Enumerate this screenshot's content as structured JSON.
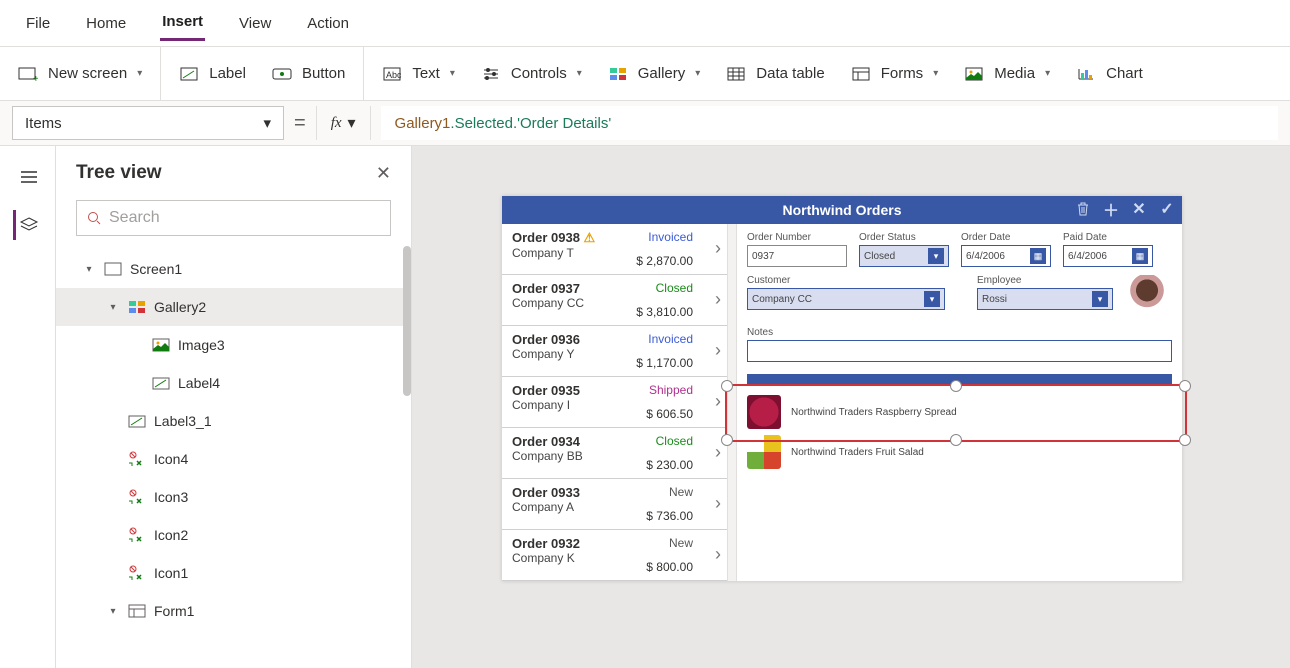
{
  "menu": {
    "items": [
      "File",
      "Home",
      "Insert",
      "View",
      "Action"
    ],
    "active": 2
  },
  "ribbon": {
    "newScreen": "New screen",
    "label": "Label",
    "button": "Button",
    "text": "Text",
    "controls": "Controls",
    "gallery": "Gallery",
    "dataTable": "Data table",
    "forms": "Forms",
    "media": "Media",
    "chart": "Chart"
  },
  "formula": {
    "property": "Items",
    "fx": "fx",
    "expr_obj": "Gallery1",
    "expr_rest": ".Selected.'Order Details'"
  },
  "side": {
    "title": "Tree view",
    "search_ph": "Search",
    "nodes": [
      {
        "n": "Screen1",
        "d": 0,
        "t": "screen",
        "tw": "▾"
      },
      {
        "n": "Gallery2",
        "d": 1,
        "t": "gallery",
        "tw": "▾",
        "sel": true
      },
      {
        "n": "Image3",
        "d": 2,
        "t": "image"
      },
      {
        "n": "Label4",
        "d": 2,
        "t": "label"
      },
      {
        "n": "Label3_1",
        "d": 1,
        "t": "label"
      },
      {
        "n": "Icon4",
        "d": 1,
        "t": "icon"
      },
      {
        "n": "Icon3",
        "d": 1,
        "t": "icon"
      },
      {
        "n": "Icon2",
        "d": 1,
        "t": "icon"
      },
      {
        "n": "Icon1",
        "d": 1,
        "t": "icon"
      },
      {
        "n": "Form1",
        "d": 1,
        "t": "form",
        "tw": "▾"
      }
    ]
  },
  "app": {
    "title": "Northwind Orders",
    "orders": [
      {
        "id": "Order 0938",
        "co": "Company T",
        "st": "Invoiced",
        "stc": "st-invoiced",
        "amt": "$ 2,870.00",
        "warn": true
      },
      {
        "id": "Order 0937",
        "co": "Company CC",
        "st": "Closed",
        "stc": "st-closed",
        "amt": "$ 3,810.00"
      },
      {
        "id": "Order 0936",
        "co": "Company Y",
        "st": "Invoiced",
        "stc": "st-invoiced",
        "amt": "$ 1,170.00"
      },
      {
        "id": "Order 0935",
        "co": "Company I",
        "st": "Shipped",
        "stc": "st-shipped",
        "amt": "$ 606.50"
      },
      {
        "id": "Order 0934",
        "co": "Company BB",
        "st": "Closed",
        "stc": "st-closed",
        "amt": "$ 230.00"
      },
      {
        "id": "Order 0933",
        "co": "Company A",
        "st": "New",
        "stc": "st-new",
        "amt": "$ 736.00"
      },
      {
        "id": "Order 0932",
        "co": "Company K",
        "st": "New",
        "stc": "st-new",
        "amt": "$ 800.00"
      }
    ],
    "detail": {
      "lbl_orderNum": "Order Number",
      "orderNum": "0937",
      "lbl_status": "Order Status",
      "status": "Closed",
      "lbl_odate": "Order Date",
      "odate": "6/4/2006",
      "lbl_pdate": "Paid Date",
      "pdate": "6/4/2006",
      "lbl_customer": "Customer",
      "customer": "Company CC",
      "lbl_employee": "Employee",
      "employee": "Rossi",
      "lbl_notes": "Notes",
      "items": [
        {
          "name": "Northwind Traders Raspberry Spread",
          "img": "ras"
        },
        {
          "name": "Northwind Traders Fruit Salad",
          "img": "fruit"
        }
      ]
    }
  }
}
